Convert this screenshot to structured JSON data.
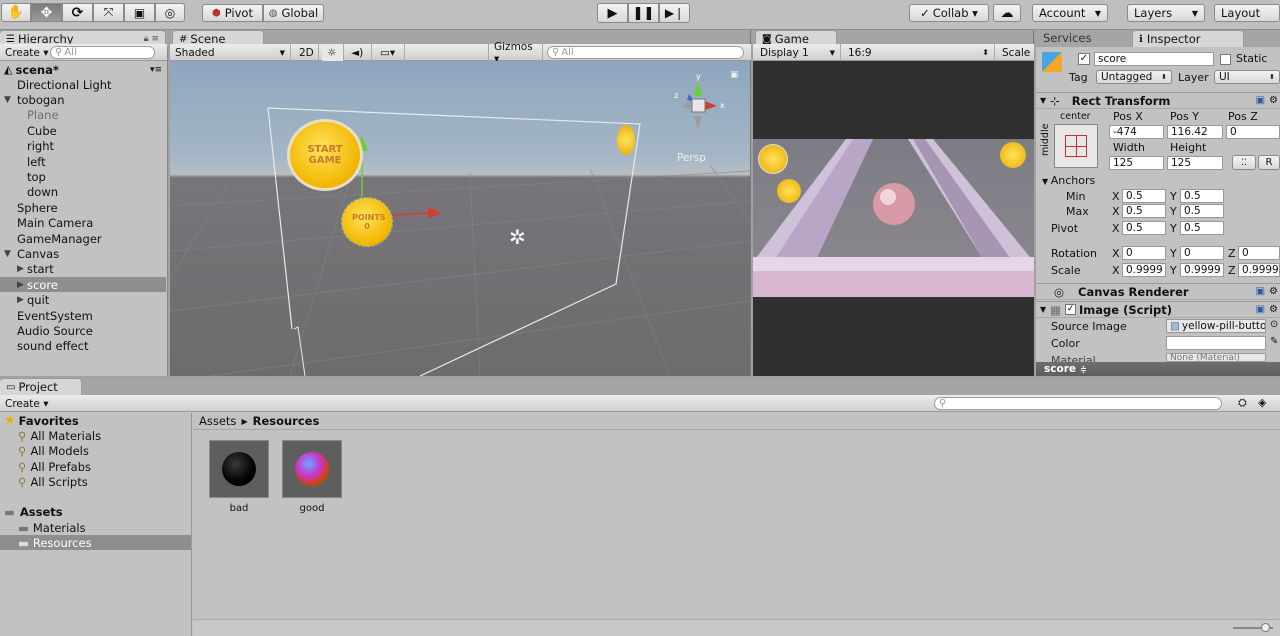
{
  "toolbar": {
    "tools": [
      "hand-icon",
      "move-icon",
      "rotate-icon",
      "scale-icon",
      "rect-icon",
      "transform-icon"
    ],
    "pivot_label": "Pivot",
    "global_label": "Global",
    "collab_label": "Collab ▾",
    "account_label": "Account",
    "layers_label": "Layers",
    "layout_label": "Layout"
  },
  "hierarchy": {
    "tab_label": "Hierarchy",
    "create_label": "Create ▾",
    "search_placeholder": "All",
    "scene_name": "scena*",
    "items": [
      {
        "label": "Directional Light",
        "indent": 1,
        "arrow": "",
        "dim": false,
        "selected": false
      },
      {
        "label": "tobogan",
        "indent": 1,
        "arrow": "▼",
        "dim": false,
        "selected": false
      },
      {
        "label": "Plane",
        "indent": 2,
        "arrow": "",
        "dim": true,
        "selected": false
      },
      {
        "label": "Cube",
        "indent": 2,
        "arrow": "",
        "dim": false,
        "selected": false
      },
      {
        "label": "right",
        "indent": 2,
        "arrow": "",
        "dim": false,
        "selected": false
      },
      {
        "label": "left",
        "indent": 2,
        "arrow": "",
        "dim": false,
        "selected": false
      },
      {
        "label": "top",
        "indent": 2,
        "arrow": "",
        "dim": false,
        "selected": false
      },
      {
        "label": "down",
        "indent": 2,
        "arrow": "",
        "dim": false,
        "selected": false
      },
      {
        "label": "Sphere",
        "indent": 1,
        "arrow": "",
        "dim": false,
        "selected": false
      },
      {
        "label": "Main Camera",
        "indent": 1,
        "arrow": "",
        "dim": false,
        "selected": false
      },
      {
        "label": "GameManager",
        "indent": 1,
        "arrow": "",
        "dim": false,
        "selected": false
      },
      {
        "label": "Canvas",
        "indent": 1,
        "arrow": "▼",
        "dim": false,
        "selected": false
      },
      {
        "label": "start",
        "indent": 2,
        "arrow": "▶",
        "dim": false,
        "selected": false
      },
      {
        "label": "score",
        "indent": 2,
        "arrow": "▶",
        "dim": false,
        "selected": true
      },
      {
        "label": "quit",
        "indent": 2,
        "arrow": "▶",
        "dim": false,
        "selected": false
      },
      {
        "label": "EventSystem",
        "indent": 1,
        "arrow": "",
        "dim": false,
        "selected": false
      },
      {
        "label": "Audio Source",
        "indent": 1,
        "arrow": "",
        "dim": false,
        "selected": false
      },
      {
        "label": "sound effect",
        "indent": 1,
        "arrow": "",
        "dim": false,
        "selected": false
      }
    ]
  },
  "scene": {
    "tab_label": "Scene",
    "shading": "Shaded",
    "mode_2d": "2D",
    "gizmos": "Gizmos ▾",
    "search_placeholder": "All",
    "persp": "Persp",
    "start_btn": "START GAME",
    "points_btn": "POINTS 0"
  },
  "game": {
    "tab_label": "Game",
    "display": "Display 1",
    "aspect": "16:9",
    "scale": "Scale"
  },
  "inspector": {
    "services_tab": "Services",
    "inspector_tab": "Inspector",
    "object_name": "score",
    "static_label": "Static",
    "tag_label": "Tag",
    "tag_value": "Untagged",
    "layer_label": "Layer",
    "layer_value": "UI",
    "rect_transform": "Rect Transform",
    "anchor_h": "center",
    "anchor_v": "middle",
    "posx_label": "Pos X",
    "posx": "-474",
    "posy_label": "Pos Y",
    "posy": "116.42",
    "posz_label": "Pos Z",
    "posz": "0",
    "width_label": "Width",
    "width": "125",
    "height_label": "Height",
    "height": "125",
    "anchors_label": "Anchors",
    "min_label": "Min",
    "min_x": "0.5",
    "min_y": "0.5",
    "max_label": "Max",
    "max_x": "0.5",
    "max_y": "0.5",
    "pivot_label": "Pivot",
    "pivot_x": "0.5",
    "pivot_y": "0.5",
    "rotation_label": "Rotation",
    "rot_x": "0",
    "rot_y": "0",
    "rot_z": "0",
    "scale_label": "Scale",
    "scale_x": "0.9999",
    "scale_y": "0.9999",
    "scale_z": "0.9999",
    "canvas_renderer": "Canvas Renderer",
    "image_script": "Image (Script)",
    "source_image_label": "Source Image",
    "source_image_value": "yellow-pill-butto",
    "color_label": "Color",
    "material_label": "Material",
    "material_value": "None (Material)",
    "footer_label": "score"
  },
  "project": {
    "tab_label": "Project",
    "create_label": "Create ▾",
    "favorites_label": "Favorites",
    "favorites": [
      "All Materials",
      "All Models",
      "All Prefabs",
      "All Scripts"
    ],
    "assets_label": "Assets",
    "folders": [
      "Materials",
      "Resources"
    ],
    "breadcrumb_root": "Assets",
    "breadcrumb_current": "Resources",
    "assets": [
      {
        "name": "bad"
      },
      {
        "name": "good"
      }
    ]
  }
}
